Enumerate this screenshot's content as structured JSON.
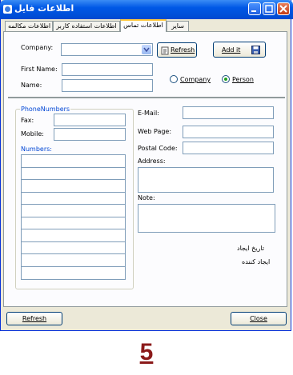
{
  "window": {
    "title": "اطلاعات فایل"
  },
  "tabs": [
    {
      "label": "سایر"
    },
    {
      "label": "اطلاعات تماس",
      "active": true
    },
    {
      "label": "اطلاعات استفاده کاربر"
    },
    {
      "label": "اطلاعات مکالمه"
    }
  ],
  "form": {
    "company_label": "Company:",
    "company_value": "",
    "refresh_label": "Refresh",
    "addit_label": "Add it",
    "firstname_label": "First Name:",
    "firstname_value": "",
    "name_label": "Name:",
    "name_value": "",
    "radio_company_label": "Company",
    "radio_person_label": "Person",
    "radio_selected": "Person",
    "phone_group_label": "PhoneNumbers",
    "fax_label": "Fax:",
    "fax_value": "",
    "mobile_label": "Mobile:",
    "mobile_value": "",
    "numbers_label": "Numbers:",
    "email_label": "E-Mail:",
    "email_value": "",
    "webpage_label": "Web Page:",
    "webpage_value": "",
    "postal_label": "Postal Code:",
    "postal_value": "",
    "address_label": "Address:",
    "note_label": "Note:",
    "created_date_label": "تاریخ ایجاد",
    "creator_label": "ایجاد کننده"
  },
  "footer": {
    "refresh_label": "Refresh",
    "close_label": "Close"
  },
  "page_number": "5",
  "colors": {
    "titlebar": "#0058e6",
    "accent_tab": "#ffc83c",
    "group_label": "#0046d5",
    "page_number": "#8b1a1a"
  }
}
